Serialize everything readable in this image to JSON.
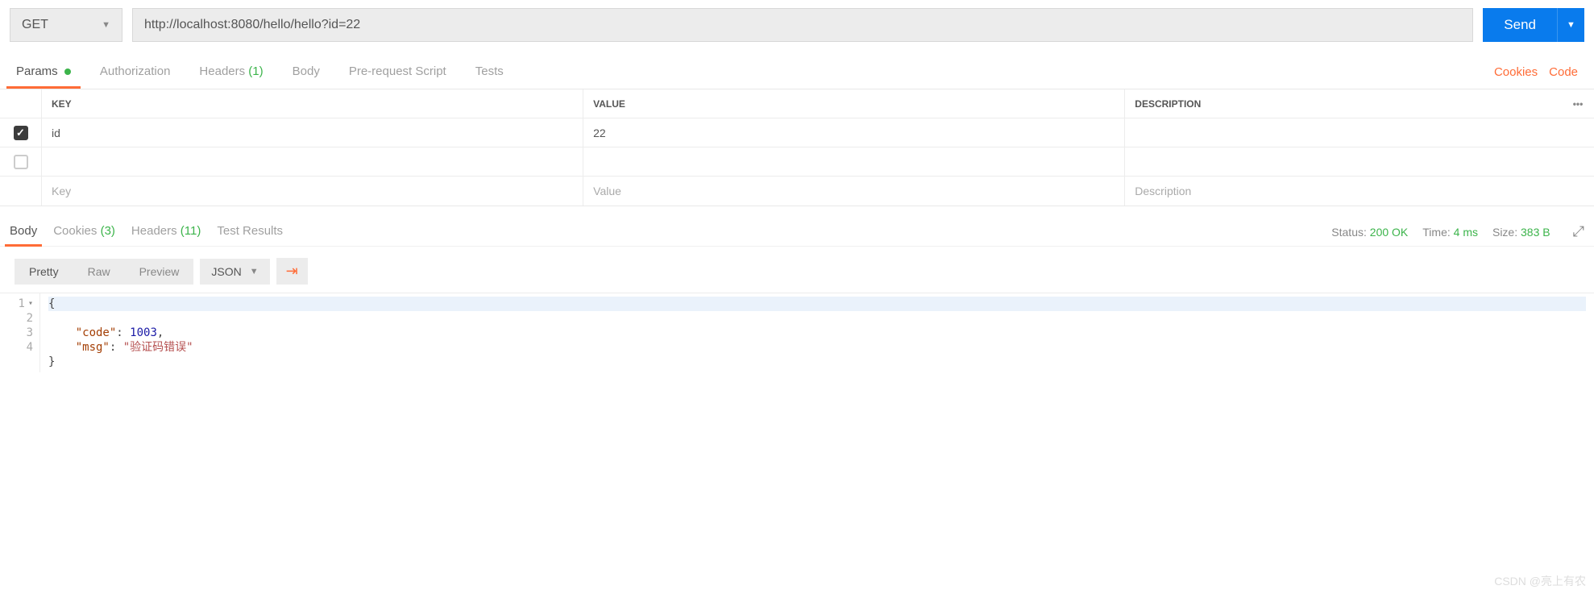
{
  "request": {
    "method": "GET",
    "url": "http://localhost:8080/hello/hello?id=22",
    "send_label": "Send"
  },
  "req_tabs": {
    "params": "Params",
    "authorization": "Authorization",
    "headers": "Headers",
    "headers_count": "(1)",
    "body": "Body",
    "prerequest": "Pre-request Script",
    "tests": "Tests"
  },
  "right_links": {
    "cookies": "Cookies",
    "code": "Code"
  },
  "params_table": {
    "key_header": "KEY",
    "value_header": "VALUE",
    "desc_header": "DESCRIPTION",
    "rows": [
      {
        "key": "id",
        "value": "22",
        "desc": ""
      }
    ],
    "key_ph": "Key",
    "value_ph": "Value",
    "desc_ph": "Description"
  },
  "resp_tabs": {
    "body": "Body",
    "cookies": "Cookies",
    "cookies_count": "(3)",
    "headers": "Headers",
    "headers_count": "(11)",
    "testresults": "Test Results"
  },
  "status": {
    "status_label": "Status:",
    "status_val": "200 OK",
    "time_label": "Time:",
    "time_val": "4 ms",
    "size_label": "Size:",
    "size_val": "383 B"
  },
  "body_toolbar": {
    "pretty": "Pretty",
    "raw": "Raw",
    "preview": "Preview",
    "format": "JSON"
  },
  "response_body": {
    "code_key": "\"code\"",
    "code_val": "1003",
    "msg_key": "\"msg\"",
    "msg_val": "\"验证码错误\""
  },
  "watermark": "CSDN @亮上有农"
}
